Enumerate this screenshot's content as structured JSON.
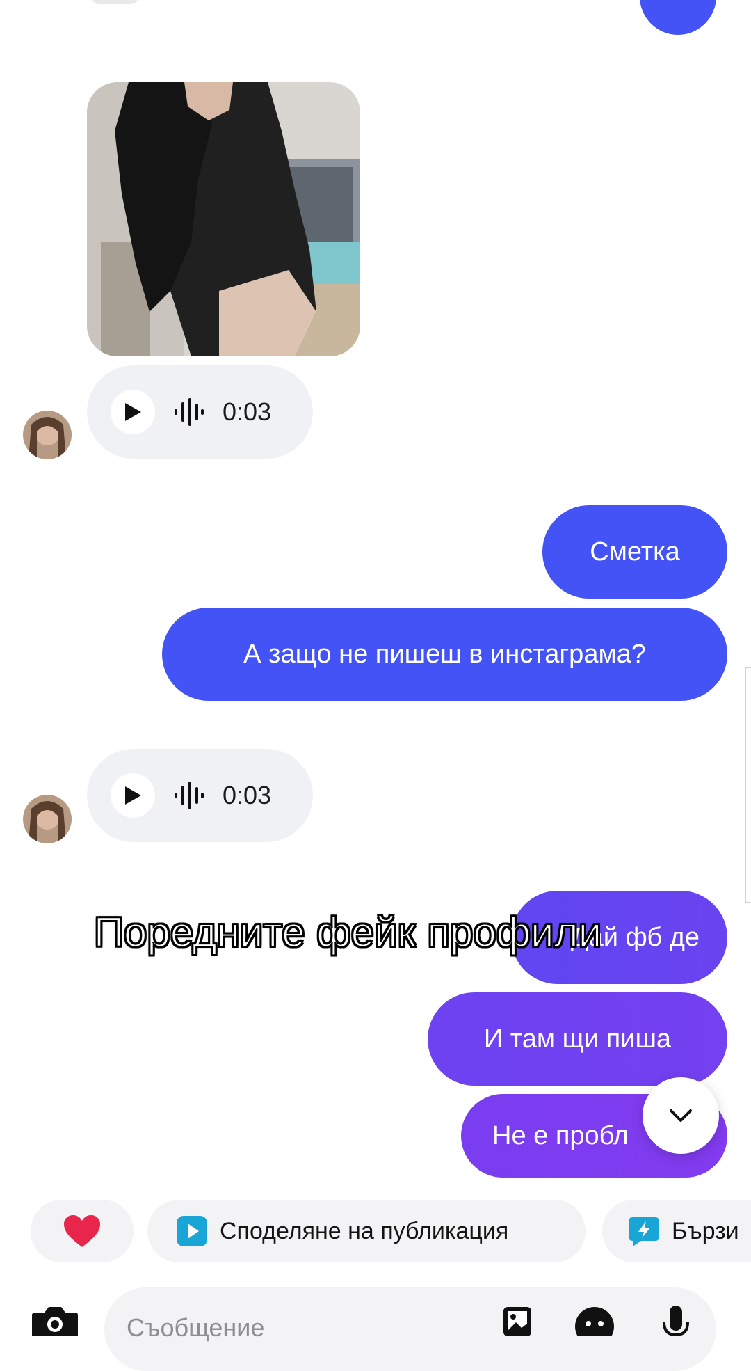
{
  "colors": {
    "outgoing_bubble_blue": "#4353f5",
    "outgoing_bubble_purple": "#7a3df0",
    "incoming_bubble": "#f0f1f4",
    "heart": "#e8254a",
    "chip_icon_blue": "#19a6d6"
  },
  "messages": [
    {
      "direction": "incoming",
      "type": "image",
      "icon": "photo-image"
    },
    {
      "direction": "incoming",
      "type": "voice",
      "duration": "0:03"
    },
    {
      "direction": "outgoing",
      "type": "text",
      "text": "Сметка"
    },
    {
      "direction": "outgoing",
      "type": "text",
      "text": "А защо не пишеш в инстаграма?"
    },
    {
      "direction": "incoming",
      "type": "voice",
      "duration": "0:03"
    },
    {
      "direction": "outgoing",
      "type": "text",
      "text": "Дай фб де"
    },
    {
      "direction": "outgoing",
      "type": "text",
      "text": "И там щи пиша"
    },
    {
      "direction": "outgoing",
      "type": "text",
      "text": "Не е пробл"
    }
  ],
  "overlay": {
    "caption": "Поредните фейк профили"
  },
  "quick_actions": [
    {
      "icon": "heart-icon",
      "label": ""
    },
    {
      "icon": "share-post-icon",
      "label": "Споделяне на публикация"
    },
    {
      "icon": "quick-reply-icon",
      "label": "Бързи"
    }
  ],
  "composer": {
    "placeholder": "Съобщение",
    "icons": [
      "camera-icon",
      "gallery-icon",
      "sticker-icon",
      "microphone-icon"
    ]
  }
}
